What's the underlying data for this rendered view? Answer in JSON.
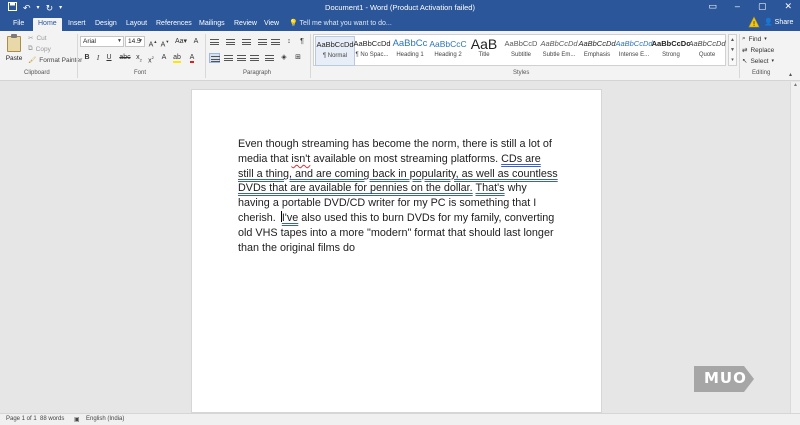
{
  "window": {
    "title": "Document1 - Word (Product Activation failed)",
    "share_label": "Share"
  },
  "quick_access": {
    "icons": [
      "save-icon",
      "undo-icon",
      "redo-icon",
      "customize-icon"
    ]
  },
  "tabs": [
    {
      "label": "File",
      "active": false
    },
    {
      "label": "Home",
      "active": true
    },
    {
      "label": "Insert",
      "active": false
    },
    {
      "label": "Design",
      "active": false
    },
    {
      "label": "Layout",
      "active": false
    },
    {
      "label": "References",
      "active": false
    },
    {
      "label": "Mailings",
      "active": false
    },
    {
      "label": "Review",
      "active": false
    },
    {
      "label": "View",
      "active": false
    }
  ],
  "tell_me": {
    "placeholder": "Tell me what you want to do..."
  },
  "ribbon": {
    "clipboard": {
      "paste_label": "Paste",
      "cut_label": "Cut",
      "copy_label": "Copy",
      "format_painter_label": "Format Painter",
      "group_label": "Clipboard"
    },
    "font": {
      "name": "Arial",
      "size": "14.5",
      "group_label": "Font"
    },
    "paragraph": {
      "group_label": "Paragraph"
    },
    "styles": {
      "group_label": "Styles",
      "items": [
        {
          "preview": "AaBbCcDd",
          "name": "¶ Normal",
          "selected": true
        },
        {
          "preview": "AaBbCcDd",
          "name": "¶ No Spac...",
          "selected": false
        },
        {
          "preview": "AaBbCc",
          "name": "Heading 1",
          "selected": false
        },
        {
          "preview": "AaBbCcC",
          "name": "Heading 2",
          "selected": false
        },
        {
          "preview": "AaB",
          "name": "Title",
          "selected": false
        },
        {
          "preview": "AaBbCcD",
          "name": "Subtitle",
          "selected": false
        },
        {
          "preview": "AaBbCcDd",
          "name": "Subtle Em...",
          "selected": false
        },
        {
          "preview": "AaBbCcDd",
          "name": "Emphasis",
          "selected": false
        },
        {
          "preview": "AaBbCcDd",
          "name": "Intense E...",
          "selected": false
        },
        {
          "preview": "AaBbCcDc",
          "name": "Strong",
          "selected": false
        },
        {
          "preview": "AaBbCcDd",
          "name": "Quote",
          "selected": false
        }
      ]
    },
    "editing": {
      "find_label": "Find",
      "replace_label": "Replace",
      "select_label": "Select",
      "group_label": "Editing"
    }
  },
  "document": {
    "segments": [
      {
        "text": "Even though streaming has become the norm, there is still a lot of media that ",
        "mark": "none"
      },
      {
        "text": "isn't",
        "mark": "spelling"
      },
      {
        "text": " available on most streaming platforms. ",
        "mark": "none"
      },
      {
        "text": "CDs are still a thing, and are coming back in popularity, as well as countless DVDs that are available for pennies on the dollar.",
        "mark": "grammar"
      },
      {
        "text": " ",
        "mark": "none"
      },
      {
        "text": "That's",
        "mark": "grammar"
      },
      {
        "text": " why having a portable DVD/CD writer for my PC is something that I cherish. ",
        "mark": "none"
      },
      {
        "text": "I've",
        "mark": "grammar"
      },
      {
        "text": " also used this to burn DVDs for my family, converting old VHS tapes into a more \"modern\" format that should last longer than the original films do",
        "mark": "none"
      }
    ]
  },
  "status_bar": {
    "page": "Page 1 of 1",
    "words": "88 words",
    "language": "English (India)"
  },
  "watermark": {
    "text": "MUO"
  },
  "colors": {
    "brand": "#2b579a",
    "spelling": "#d13438",
    "grammar": "#3b5fc9"
  }
}
